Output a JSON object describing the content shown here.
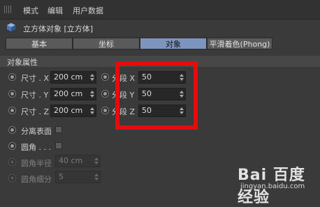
{
  "menu": {
    "items": [
      "模式",
      "编辑",
      "用户数据"
    ]
  },
  "object": {
    "title": "立方体对象 [立方体]"
  },
  "tabs": [
    "基本",
    "坐标",
    "对象",
    "平滑着色(Phong)"
  ],
  "active_tab": "对象",
  "section": {
    "title": "对象属性"
  },
  "size": [
    {
      "label": "尺寸 . X",
      "value": "200 cm"
    },
    {
      "label": "尺寸 . Y",
      "value": "200 cm"
    },
    {
      "label": "尺寸 . Z",
      "value": "200 cm"
    }
  ],
  "segments": [
    {
      "label": "分段 X",
      "value": "50"
    },
    {
      "label": "分段 Y",
      "value": "50"
    },
    {
      "label": "分段 Z",
      "value": "50"
    }
  ],
  "options": {
    "separate_surfaces": "分离表面",
    "fillet": "圆角 . . .",
    "fillet_radius_label": "圆角半径",
    "fillet_radius_value": "40 cm",
    "fillet_subdivision_label": "圆角细分",
    "fillet_subdivision_value": "5"
  },
  "watermark": {
    "logo": "Bai 百度 经验",
    "url": "jingyan.baidu.com"
  },
  "colors": {
    "active_tab": "#7d95bd",
    "highlight": "#e30d0d"
  }
}
